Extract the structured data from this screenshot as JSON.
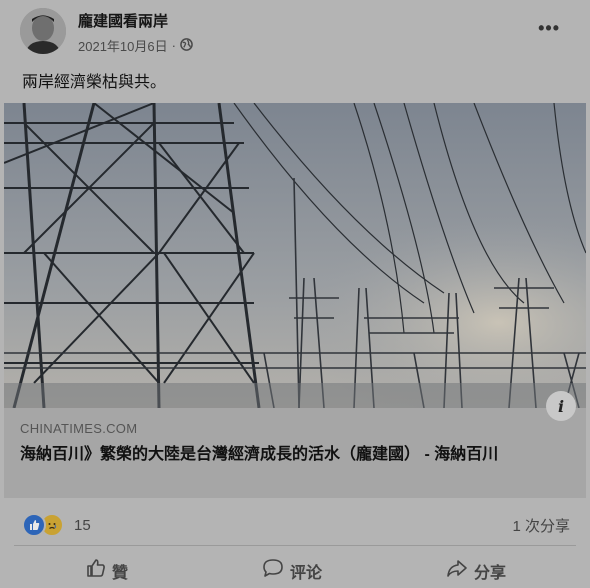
{
  "post": {
    "author": "龐建國看兩岸",
    "date": "2021年10月6日",
    "separator": "·",
    "audience_icon": "globe-icon",
    "more_label": "•••",
    "text": "兩岸經濟榮枯與共。"
  },
  "link_card": {
    "domain": "CHINATIMES.COM",
    "headline": "海納百川》繁榮的大陸是台灣經濟成長的活水（龐建國） - 海納百川",
    "info_label": "i"
  },
  "engagement": {
    "reaction_count": "15",
    "share_count": "1 次分享"
  },
  "actions": {
    "like": "贊",
    "comment": "评论",
    "share": "分享"
  },
  "colors": {
    "background": "#b4b4b4",
    "like_blue": "#2d65b8",
    "sad_yellow": "#c9a233"
  }
}
